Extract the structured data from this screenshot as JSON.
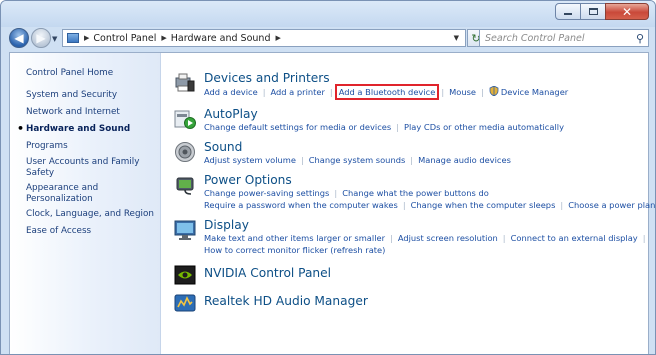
{
  "window": {
    "address_crumbs": [
      "Control Panel",
      "Hardware and Sound"
    ],
    "search_placeholder": "Search Control Panel",
    "minimize_icon": "minimize-icon",
    "maximize_icon": "maximize-icon",
    "close_icon": "close-icon"
  },
  "sidebar": {
    "items": [
      {
        "label": "Control Panel Home"
      },
      {
        "label": "System and Security"
      },
      {
        "label": "Network and Internet"
      },
      {
        "label": "Hardware and Sound",
        "active": true
      },
      {
        "label": "Programs"
      },
      {
        "label": "User Accounts and Family Safety"
      },
      {
        "label": "Appearance and Personalization"
      },
      {
        "label": "Clock, Language, and Region"
      },
      {
        "label": "Ease of Access"
      }
    ]
  },
  "categories": [
    {
      "title": "Devices and Printers",
      "icon": "devices-printers-icon",
      "link_rows": [
        [
          "Add a device",
          "Add a printer",
          "Add a Bluetooth device",
          "Mouse",
          "Device Manager"
        ]
      ],
      "highlighted_link": "Add a Bluetooth device",
      "highlight_color": "#e0242c"
    },
    {
      "title": "AutoPlay",
      "icon": "autoplay-icon",
      "link_rows": [
        [
          "Change default settings for media or devices",
          "Play CDs or other media automatically"
        ]
      ]
    },
    {
      "title": "Sound",
      "icon": "speaker-icon",
      "link_rows": [
        [
          "Adjust system volume",
          "Change system sounds",
          "Manage audio devices"
        ]
      ]
    },
    {
      "title": "Power Options",
      "icon": "power-options-icon",
      "link_rows": [
        [
          "Change power-saving settings",
          "Change what the power buttons do"
        ],
        [
          "Require a password when the computer wakes",
          "Change when the computer sleeps",
          "Choose a power plan"
        ]
      ]
    },
    {
      "title": "Display",
      "icon": "display-icon",
      "link_rows": [
        [
          "Make text and other items larger or smaller",
          "Adjust screen resolution",
          "Connect to an external display"
        ],
        [
          "How to correct monitor flicker (refresh rate)"
        ]
      ]
    },
    {
      "title": "NVIDIA Control Panel",
      "icon": "nvidia-icon",
      "link_rows": []
    },
    {
      "title": "Realtek HD Audio Manager",
      "icon": "realtek-audio-icon",
      "link_rows": []
    }
  ]
}
